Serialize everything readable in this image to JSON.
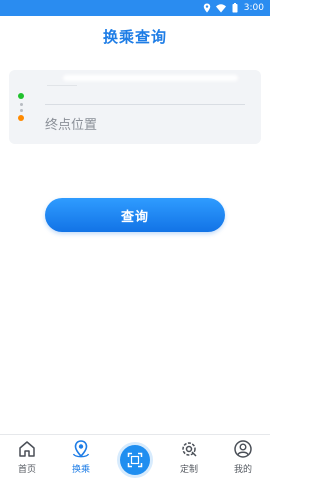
{
  "status_bar": {
    "time": "3:00",
    "icons": [
      "location-icon",
      "wifi-icon",
      "battery-icon"
    ],
    "background": "#2a8cf0"
  },
  "header": {
    "title": "换乘查询"
  },
  "route": {
    "start_placeholder": "",
    "end_placeholder": "终点位置",
    "start_dot_color": "#21c12e",
    "end_dot_color": "#ff8a00"
  },
  "query_button": {
    "label": "查询"
  },
  "tabs": [
    {
      "label": "首页",
      "icon": "home-icon",
      "active": false
    },
    {
      "label": "换乘",
      "icon": "transfer-location-icon",
      "active": true
    },
    {
      "label": "",
      "icon": "scan-icon",
      "active": false
    },
    {
      "label": "定制",
      "icon": "custom-gear-icon",
      "active": false
    },
    {
      "label": "我的",
      "icon": "profile-icon",
      "active": false
    }
  ],
  "colors": {
    "accent": "#1e7de6",
    "card_background": "#f2f4f7"
  }
}
